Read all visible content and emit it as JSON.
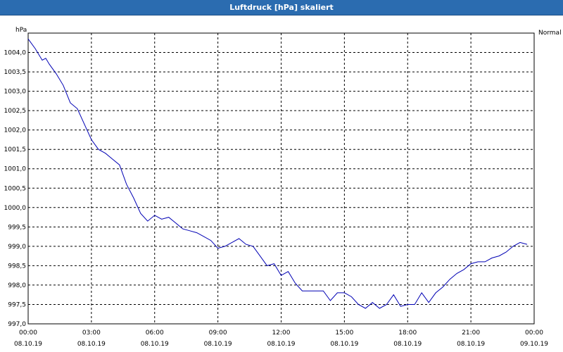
{
  "window": {
    "title": "Luftdruck [hPa] skaliert"
  },
  "chart_data": {
    "type": "line",
    "title": "Luftdruck [hPa] skaliert",
    "ylabel": "hPa",
    "xlabel": "",
    "ylim": [
      997.0,
      1004.5
    ],
    "xlim": [
      "08.10.19 00:00",
      "09.10.19 00:00"
    ],
    "grid": true,
    "legend_placement": "top-right",
    "colors": {
      "series": "#0000b4",
      "grid": "#000000",
      "title_bar": "#2b6cb0"
    },
    "y_ticks": [
      "997,0",
      "997,5",
      "998,0",
      "998,5",
      "999,0",
      "999,5",
      "1000,0",
      "1000,5",
      "1001,0",
      "1001,5",
      "1002,0",
      "1002,5",
      "1003,0",
      "1003,5",
      "1004,0"
    ],
    "x_ticks": [
      {
        "time": "00:00",
        "date": "08.10.19"
      },
      {
        "time": "03:00",
        "date": "08.10.19"
      },
      {
        "time": "06:00",
        "date": "08.10.19"
      },
      {
        "time": "09:00",
        "date": "08.10.19"
      },
      {
        "time": "12:00",
        "date": "08.10.19"
      },
      {
        "time": "15:00",
        "date": "08.10.19"
      },
      {
        "time": "18:00",
        "date": "08.10.19"
      },
      {
        "time": "21:00",
        "date": "08.10.19"
      },
      {
        "time": "00:00",
        "date": "09.10.19"
      }
    ],
    "series": [
      {
        "name": "Normal",
        "x": [
          "00:00",
          "00:20",
          "00:40",
          "00:50",
          "01:00",
          "01:20",
          "01:40",
          "02:00",
          "02:20",
          "02:40",
          "03:00",
          "03:20",
          "03:40",
          "04:00",
          "04:20",
          "04:40",
          "05:00",
          "05:20",
          "05:40",
          "06:00",
          "06:20",
          "06:40",
          "07:00",
          "07:20",
          "07:40",
          "08:00",
          "08:20",
          "08:40",
          "09:00",
          "09:20",
          "09:40",
          "10:00",
          "10:20",
          "10:40",
          "11:00",
          "11:20",
          "11:40",
          "12:00",
          "12:20",
          "12:40",
          "13:00",
          "13:20",
          "13:40",
          "14:00",
          "14:20",
          "14:40",
          "15:00",
          "15:20",
          "15:40",
          "16:00",
          "16:20",
          "16:40",
          "17:00",
          "17:20",
          "17:40",
          "18:00",
          "18:20",
          "18:40",
          "19:00",
          "19:20",
          "19:40",
          "20:00",
          "20:20",
          "20:40",
          "21:00",
          "21:20",
          "21:40",
          "22:00",
          "22:20",
          "22:40",
          "23:00",
          "23:20",
          "23:40"
        ],
        "y": [
          1004.35,
          1004.1,
          1003.8,
          1003.85,
          1003.7,
          1003.45,
          1003.15,
          1002.7,
          1002.55,
          1002.15,
          1001.75,
          1001.5,
          1001.4,
          1001.25,
          1001.1,
          1000.6,
          1000.25,
          999.85,
          999.65,
          999.8,
          999.7,
          999.75,
          999.6,
          999.45,
          999.4,
          999.35,
          999.25,
          999.15,
          998.95,
          999.0,
          999.1,
          999.2,
          999.05,
          999.0,
          998.75,
          998.5,
          998.55,
          998.25,
          998.35,
          998.05,
          997.85,
          997.85,
          997.85,
          997.85,
          997.6,
          997.8,
          997.8,
          997.7,
          997.5,
          997.4,
          997.55,
          997.4,
          997.5,
          997.75,
          997.45,
          997.5,
          997.5,
          997.8,
          997.55,
          997.8,
          997.95,
          998.15,
          998.3,
          998.4,
          998.55,
          998.6,
          998.6,
          998.7,
          998.75,
          998.85,
          999.0,
          999.1,
          999.05
        ]
      }
    ]
  }
}
